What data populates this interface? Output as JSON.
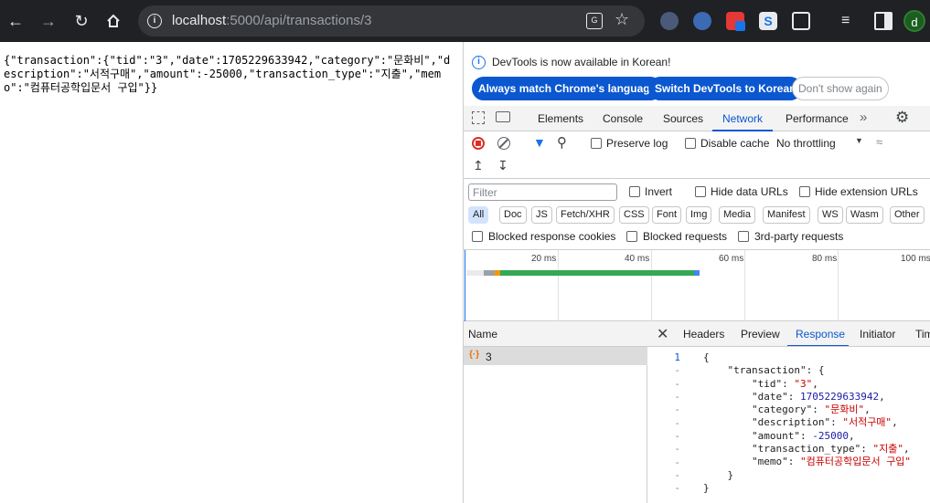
{
  "browser": {
    "url_host": "localhost",
    "url_path": ":5000/api/transactions/3",
    "avatar_letter": "d"
  },
  "page": {
    "json_text": "{\"transaction\":{\"tid\":\"3\",\"date\":1705229633942,\"category\":\"문화비\",\"description\":\"서적구매\",\"amount\":-25000,\"transaction_type\":\"지출\",\"memo\":\"컴퓨터공학입문서 구입\"}}"
  },
  "devtools": {
    "info_message": "DevTools is now available in Korean!",
    "btn_match_language": "Always match Chrome's language",
    "btn_switch_korean": "Switch DevTools to Korean",
    "btn_dont_show": "Don't show again",
    "tabs": [
      "Elements",
      "Console",
      "Sources",
      "Network",
      "Performance"
    ],
    "active_tab": "Network",
    "preserve_log": "Preserve log",
    "disable_cache": "Disable cache",
    "throttling": "No throttling",
    "filter_placeholder": "Filter",
    "invert": "Invert",
    "hide_data_urls": "Hide data URLs",
    "hide_extension_urls": "Hide extension URLs",
    "type_filters": [
      "All",
      "Doc",
      "JS",
      "Fetch/XHR",
      "CSS",
      "Font",
      "Img",
      "Media",
      "Manifest",
      "WS",
      "Wasm",
      "Other"
    ],
    "blocked_cookies": "Blocked response cookies",
    "blocked_requests": "Blocked requests",
    "third_party": "3rd-party requests",
    "timeline_ticks": [
      "20 ms",
      "40 ms",
      "60 ms",
      "80 ms",
      "100 ms"
    ],
    "name_header": "Name",
    "request_name": "3",
    "detail_tabs": [
      "Headers",
      "Preview",
      "Response",
      "Initiator",
      "Timing"
    ],
    "active_detail_tab": "Response",
    "line_numbers": [
      "1",
      "-",
      "-",
      "-",
      "-",
      "-",
      "-",
      "-",
      "-",
      "-",
      "-",
      "-"
    ]
  },
  "response": {
    "key_transaction": "\"transaction\"",
    "tid_key": "\"tid\"",
    "tid_val": "\"3\"",
    "date_key": "\"date\"",
    "date_val": "1705229633942",
    "category_key": "\"category\"",
    "category_val": "\"문화비\"",
    "description_key": "\"description\"",
    "description_val": "\"서적구매\"",
    "amount_key": "\"amount\"",
    "amount_val": "-25000",
    "type_key": "\"transaction_type\"",
    "type_val": "\"지출\"",
    "memo_key": "\"memo\"",
    "memo_val": "\"컴퓨터공학입문서 구입\""
  },
  "colors": {
    "accent": "#0b57d0",
    "waterfall_green": "#34a853",
    "waterfall_orange": "#f29900",
    "waterfall_blue": "#4285f4"
  }
}
